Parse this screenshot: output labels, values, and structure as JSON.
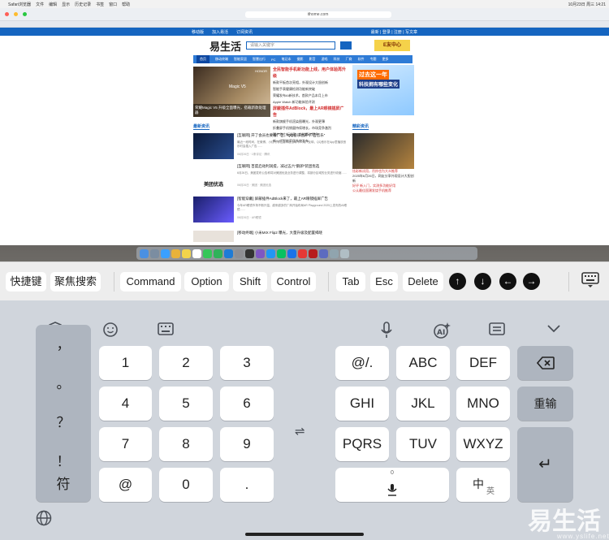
{
  "desktop": {
    "menubar": {
      "items": [
        "Safari浏览器",
        "文件",
        "编辑",
        "显示",
        "历史记录",
        "书签",
        "窗口",
        "帮助"
      ],
      "status": "10月23日 周三 14:21"
    },
    "browser": {
      "address": "ithome.com",
      "site_top_links": [
        "移动版",
        "加入易活",
        "订阅资讯"
      ],
      "site_top_right": "最新 | 登录 | 注册 | 写文章",
      "logo": "易生活",
      "search_placeholder": "请输入关键字",
      "e_center": "E友中心",
      "nav": [
        "首页",
        "移动终端",
        "智能家居",
        "智慧出行",
        "PC",
        "笔记本",
        "摄影",
        "影音",
        "游戏",
        "科技",
        "厂商",
        "软件",
        "专题",
        "更多"
      ],
      "hero_caption": "荣耀Magic V5 升级全面曝光，搭载新款处理器",
      "hero_brand": "HONOR",
      "hero_product": "Magic V5",
      "headlines": [
        "全民智能手机新功能上线，用户体验再升级",
        "新款平板首次亮相，外观设计大胆创新",
        "智能手表健康检测功能新突破",
        "荣耀发布AI新技术，首款产品本月上市",
        "Apple Watch 新功能体验评测",
        "屏蔽插件AdBlock，最上AR眼镜插屏广告",
        "新款旗舰手机渲染图曝光，外观更薄",
        "折叠屏手机销量持续增长，市场竞争激烈",
        "国产芯片新进展，性能再次提升",
        "新一代智能家居系统发布"
      ],
      "ad": {
        "line1": "过去这一年",
        "line2": "科技拥有哪些变化"
      },
      "section_latest": "最新资讯",
      "section_featured": "精彩资讯",
      "news": [
        {
          "title": "[互联网] 开了会员也要看广告，QQ音乐也开“广告音乐”",
          "desc": "最近一段时间，在微博、小红书等社交平台上有不少用户反映，QQ音乐在App里播放音乐时会插入广告……",
          "meta": "06月26日 · 1条评论 · 腾讯"
        },
        {
          "title": "[互联网] 百度启动利润提，减过五六“鹅卵”装团优选",
          "desc": "6月26日，美团发布公告称将对美团优选业务进行调整，将部分区域的业务进行收缩……",
          "meta": "06月26日 · 美团 · 美团优选",
          "thumb_label": "美团优选"
        },
        {
          "title": "[智能穿戴] 屏蔽插件AdBlock来了，最上AR眼镜插屏广告",
          "desc": "今年AR眼镜市场不断升温，越来越多的厂商开始布局AR Playground 2025上发布的AI眼镜……",
          "meta": "06月26日 · AR眼镜"
        },
        {
          "title": "[移动终端] 小米MIX Flip2 曝光，大量升级及配置揭晓",
          "desc": "",
          "meta": ""
        }
      ],
      "right_news": [
        "炫彩新试用，吊炸也为大众推荐",
        "2025年6月26日，网友分享外观设计大胆创新",
        "好评 新入门，实测多功能好用",
        "公认最佳国潮发烧手机推荐"
      ]
    }
  },
  "shortcut_bar": {
    "buttons": [
      "快捷键",
      "聚焦搜索",
      "Command",
      "Option",
      "Shift",
      "Control",
      "Tab",
      "Esc",
      "Delete"
    ],
    "arrows": [
      "up-arrow",
      "down-arrow",
      "left-arrow",
      "right-arrow"
    ],
    "keyboard_toggle_icon": "keyboard-icon"
  },
  "keyboard": {
    "toolbar_left": [
      "shield-icon",
      "emoji-icon",
      "keyboard-icon"
    ],
    "toolbar_right": [
      "mic-icon",
      "ai-icon",
      "clipboard-icon",
      "collapse-icon"
    ],
    "left_column": [
      "，",
      "。",
      "？",
      "！"
    ],
    "numpad": [
      "1",
      "2",
      "3",
      "4",
      "5",
      "6",
      "7",
      "8",
      "9"
    ],
    "symbol_key": "符",
    "at_key": "@",
    "zero_key": "0",
    "dot_key": ".",
    "t9": [
      "@/.",
      "ABC",
      "DEF",
      "GHI",
      "JKL",
      "MNO",
      "PQRS",
      "TUV",
      "WXYZ"
    ],
    "backspace": "⌫",
    "reinput": "重输",
    "space_sub": "0",
    "lang_key": "中",
    "lang_sub": "英",
    "enter": "↵",
    "swap_icon": "⇌",
    "globe_icon": "globe-icon"
  },
  "watermark": {
    "text": "易生活",
    "url": "www.yslife.net"
  }
}
